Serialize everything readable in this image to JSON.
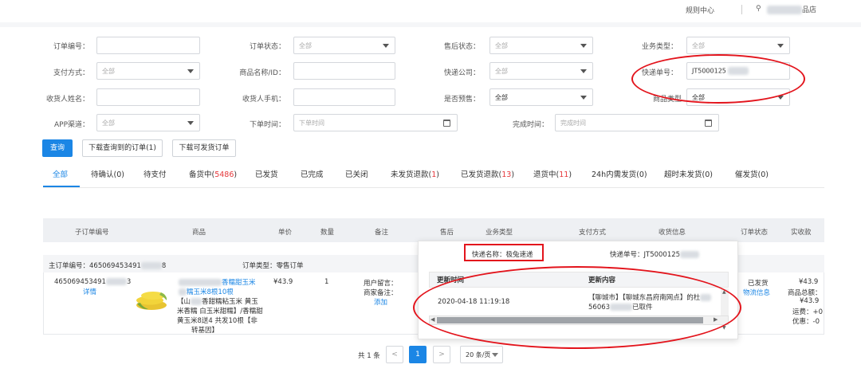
{
  "header": {
    "rules_center": "规则中心",
    "user_icon": "user-icon",
    "store_suffix": "品店"
  },
  "filters": {
    "order_no": {
      "label": "订单编号：",
      "value": ""
    },
    "order_status": {
      "label": "订单状态：",
      "value": "全部"
    },
    "after_sales_status": {
      "label": "售后状态：",
      "value": "全部"
    },
    "business_type": {
      "label": "业务类型：",
      "value": "全部"
    },
    "pay_method": {
      "label": "支付方式：",
      "value": "全部"
    },
    "product_name_id": {
      "label": "商品名称/ID：",
      "value": ""
    },
    "express_company": {
      "label": "快递公司：",
      "value": "全部"
    },
    "tracking_no": {
      "label": "快递单号：",
      "value": "JT5000125"
    },
    "receiver_name": {
      "label": "收货人姓名：",
      "value": ""
    },
    "receiver_phone": {
      "label": "收货人手机：",
      "value": ""
    },
    "presale": {
      "label": "是否预售：",
      "value": "全部"
    },
    "product_type": {
      "label": "商品类型",
      "value": "全部"
    },
    "app_channel": {
      "label": "APP渠道：",
      "value": "全部"
    },
    "order_time": {
      "label": "下单时间：",
      "placeholder": "下单时间"
    },
    "finish_time": {
      "label": "完成时间：",
      "placeholder": "完成时间"
    }
  },
  "actions": {
    "query": "查询",
    "download_queried": "下载查询到的订单(1)",
    "download_shippable": "下载可发货订单"
  },
  "tabs": [
    {
      "label": "全部",
      "count": ""
    },
    {
      "label": "待确认(0)",
      "count": ""
    },
    {
      "label": "待支付",
      "count": ""
    },
    {
      "label": "备货中(",
      "count": "5486",
      "suffix": ")"
    },
    {
      "label": "已发货",
      "count": ""
    },
    {
      "label": "已完成",
      "count": ""
    },
    {
      "label": "已关闭",
      "count": ""
    },
    {
      "label": "未发货退款(",
      "count": "1",
      "suffix": ")"
    },
    {
      "label": "已发货退款(",
      "count": "13",
      "suffix": ")"
    },
    {
      "label": "退货中(",
      "count": "11",
      "suffix": ")"
    },
    {
      "label": "24h内需发货(0)",
      "count": ""
    },
    {
      "label": "超时未发货(0)",
      "count": ""
    },
    {
      "label": "催发货(0)",
      "count": ""
    }
  ],
  "table": {
    "headers": [
      "子订单编号",
      "商品",
      "单价",
      "数量",
      "备注",
      "售后",
      "业务类型",
      "支付方式",
      "收货信息",
      "订单状态",
      "实收款"
    ],
    "group": {
      "main_order_label": "主订单编号：465069453491",
      "main_order_tail": "8",
      "order_type": "订单类型：零售订单"
    },
    "row": {
      "sub_order_no": "465069453491",
      "sub_order_tail": "3",
      "detail_link": "详情",
      "product_line1": "香糯甜玉米",
      "product_line2": "糯玉米8根10根",
      "product_desc": [
        "【山",
        "香甜糯粘玉米 黄玉",
        "米香糯 白玉米甜糯】/香糯甜",
        "黄玉米8送4 共发10根【非",
        "转基因】"
      ],
      "price": "¥43.9",
      "qty": "1",
      "user_msg": "用户留言：",
      "merchant_note": "商家备注：",
      "add_link": "添加",
      "status": "已发货",
      "logistics_link": "物流信息",
      "amount": "¥43.9",
      "total_label": "商品总额：",
      "total": "¥43.9",
      "shipping": "运费：+0",
      "discount": "优惠：-0"
    }
  },
  "popup": {
    "express_name": "快递名称：极兔速递",
    "tracking_label": "快递单号：JT5000125",
    "col_time": "更新时间",
    "col_content": "更新内容",
    "record_time": "2020-04-18 11:19:18",
    "record_line1": "【聊城市】【聊城东昌府南网点】的杜",
    "record_line2_pre": "56063",
    "record_line2_post": "已取件"
  },
  "pagination": {
    "total": "共 1 条",
    "prev": "<",
    "page": "1",
    "next": ">",
    "page_size": "20 条/页"
  },
  "colors": {
    "primary": "#1b86e5",
    "danger": "#e5383b",
    "annotation": "#e3141c"
  }
}
